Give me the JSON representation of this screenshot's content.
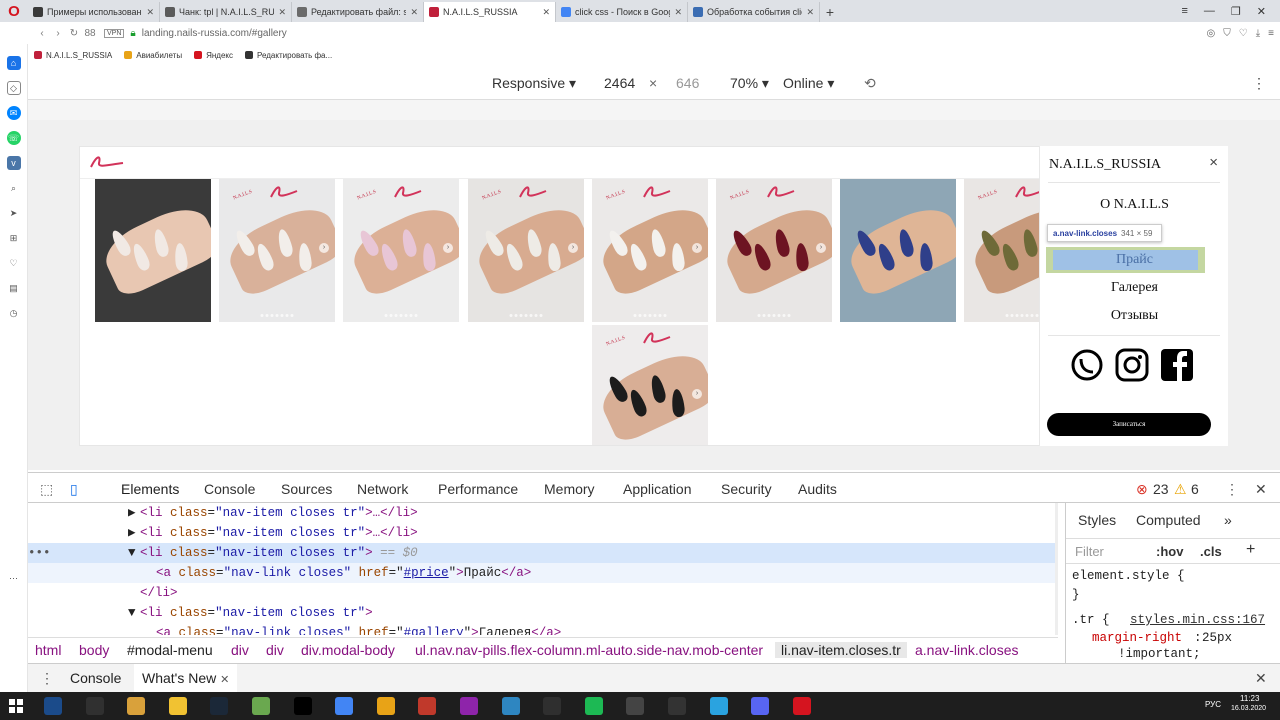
{
  "browser": {
    "tabs": [
      {
        "label": "Примеры использовани",
        "color": "#3a3a3a",
        "active": false
      },
      {
        "label": "Чанк: tpl | N.A.I.L.S_RUSSIA",
        "color": "#5b5b5b",
        "active": false
      },
      {
        "label": "Редактировать файл: style",
        "color": "#6b6b6b",
        "active": false
      },
      {
        "label": "N.A.I.L.S_RUSSIA",
        "color": "#c0203b",
        "active": true
      },
      {
        "label": "click css - Поиск в Google",
        "color": "#4285f4",
        "active": false
      },
      {
        "label": "Обработка события click",
        "color": "#3b6db3",
        "active": false
      }
    ],
    "address": {
      "vpn": "VPN",
      "url": "landing.nails-russia.com/#gallery",
      "tab_count": "88"
    },
    "bookmarks": [
      "N.A.I.L.S_RUSSIA",
      "Авиабилеты",
      "Яндекс",
      "Редактировать фа..."
    ]
  },
  "device_toolbar": {
    "mode": "Responsive",
    "width": "2464",
    "times": "×",
    "height": "646",
    "zoom": "70%",
    "network": "Online"
  },
  "site": {
    "photos": [
      {
        "bg": "#3a3a3a",
        "skin": "#e8c7b2",
        "nail": "#f1e9e4",
        "logo": false,
        "arrow": false
      },
      {
        "bg": "#e9e9ea",
        "skin": "#d9b19a",
        "nail": "#f2eeea",
        "logo": true,
        "arrow": true
      },
      {
        "bg": "#ececec",
        "skin": "#dcb096",
        "nail": "#e8c6d6",
        "logo": true,
        "arrow": true
      },
      {
        "bg": "#e6e4e2",
        "skin": "#d8ab90",
        "nail": "#eeebe6",
        "logo": true,
        "arrow": true
      },
      {
        "bg": "#ebe9e8",
        "skin": "#d3a688",
        "nail": "#f3f1ee",
        "logo": true,
        "arrow": true
      },
      {
        "bg": "#e8e6e5",
        "skin": "#d5a98d",
        "nail": "#6d1422",
        "logo": true,
        "arrow": true
      },
      {
        "bg": "#8ea6b5",
        "skin": "#dfb596",
        "nail": "#2f3f8a",
        "logo": false,
        "arrow": false
      },
      {
        "bg": "#e9e6e4",
        "skin": "#c89a7c",
        "nail": "#6e6a38",
        "logo": true,
        "arrow": true
      },
      {
        "bg": "#eeecec",
        "skin": "#d8ae95",
        "nail": "#1c1c1c",
        "logo": true,
        "arrow": true
      }
    ],
    "logo_text": "N.A.I.L.S"
  },
  "side_nav": {
    "brand": "N.A.I.L.S_RUSSIA",
    "close": "×",
    "links": [
      "О N.A.I.L.S",
      "Прайс",
      "Галерея",
      "Отзывы"
    ],
    "cta": "Записаться",
    "tooltip": {
      "selector": "a.nav-link.closes",
      "size": "341 × 59"
    }
  },
  "devtools": {
    "tabs": [
      "Elements",
      "Console",
      "Sources",
      "Network",
      "Performance",
      "Memory",
      "Application",
      "Security",
      "Audits"
    ],
    "errors": "23",
    "warnings": "6",
    "dom_lines": [
      {
        "indent": 100,
        "arrow": "▶",
        "open": "<li",
        "attr": "class",
        "val": "\"nav-item closes tr\"",
        "rest": ">…</li>"
      },
      {
        "indent": 100,
        "arrow": "▶",
        "open": "<li",
        "attr": "class",
        "val": "\"nav-item closes tr\"",
        "rest": ">…</li>"
      },
      {
        "indent": 100,
        "arrow": "▼",
        "open": "<li",
        "attr": "class",
        "val": "\"nav-item closes tr\"",
        "rest": ">"
      },
      {
        "indent": 128,
        "arrow": "",
        "open": "<a",
        "attr": "class",
        "val": "\"nav-link closes\"",
        "rest": ""
      },
      {
        "indent": 112,
        "arrow": "",
        "open": "</li>",
        "attr": "",
        "val": "",
        "rest": ""
      },
      {
        "indent": 100,
        "arrow": "▼",
        "open": "<li",
        "attr": "class",
        "val": "\"nav-item closes tr\"",
        "rest": ">"
      },
      {
        "indent": 128,
        "arrow": "",
        "open": "<a",
        "attr": "class",
        "val": "\"nav-link closes\"",
        "rest": ""
      }
    ],
    "selected_marker": "== $0",
    "price_link": {
      "href_attr": "href",
      "href": "#price",
      "text": "Прайс"
    },
    "gallery_link": {
      "href_attr": "href",
      "href": "#gallery",
      "text": "Галерея"
    },
    "styles": {
      "tabs": [
        "Styles",
        "Computed"
      ],
      "filter": "Filter",
      "hov": ":hov",
      "cls": ".cls",
      "element_style": "element.style {",
      "close_brace": "}",
      "rule_selector": ".tr {",
      "rule_source": "styles.min.css:167",
      "prop": "margin-right",
      "value": "25px",
      "important": "!important;"
    },
    "breadcrumbs": [
      "html",
      "body",
      "#modal-menu",
      "div",
      "div",
      "div.modal-body",
      "ul.nav.nav-pills.flex-column.ml-auto.side-nav.mob-center",
      "li.nav-item.closes.tr",
      "a.nav-link.closes"
    ],
    "drawer_tabs": [
      "Console",
      "What's New"
    ]
  },
  "taskbar": {
    "lang": "РУС",
    "time": "11:23",
    "date": "16.03.2020",
    "apps": [
      "#1b4b8a",
      "#303030",
      "#d9a13b",
      "#f1c232",
      "#1b2838",
      "#6aa84f",
      "#000000",
      "#4285f4",
      "#e8a317",
      "#c0392b",
      "#8e24aa",
      "#2e86c1",
      "#2f2f2f",
      "#1db954",
      "#444444",
      "#333333",
      "#2aa3e0",
      "#5865f2",
      "#d5141f"
    ]
  }
}
